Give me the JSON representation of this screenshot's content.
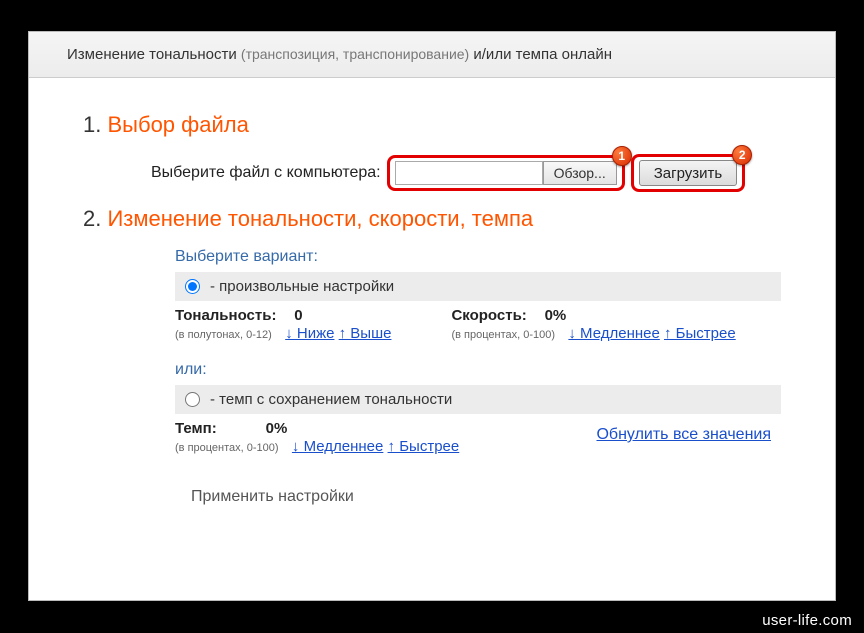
{
  "header": {
    "part1": "Изменение тональности",
    "paren": "(транспозиция, транспонирование)",
    "part2": "и/или темпа онлайн"
  },
  "step1": {
    "num": "1.",
    "title": "Выбор файла",
    "label": "Выберите файл с компьютера:",
    "browse": "Обзор...",
    "upload": "Загрузить",
    "marker1": "1",
    "marker2": "2"
  },
  "step2": {
    "num": "2.",
    "title": "Изменение тональности, скорости, темпа",
    "variant_label": "Выберите вариант:",
    "option_custom": "- произвольные настройки",
    "option_tempo": "- темп с сохранением тональности",
    "or_label": "или:",
    "tone": {
      "label": "Тональность:",
      "value": "0",
      "sub": "(в полутонах, 0-12)",
      "down": "↓ Ниже",
      "up": "↑ Выше"
    },
    "speed": {
      "label": "Скорость:",
      "value": "0%",
      "sub": "(в процентах, 0-100)",
      "down": "↓ Медленнее",
      "up": "↑ Быстрее"
    },
    "tempo": {
      "label": "Темп:",
      "value": "0%",
      "sub": "(в процентах, 0-100)",
      "down": "↓ Медленнее",
      "up": "↑ Быстрее"
    },
    "reset": "Обнулить все значения",
    "apply": "Применить настройки"
  },
  "watermark": "user-life.com"
}
